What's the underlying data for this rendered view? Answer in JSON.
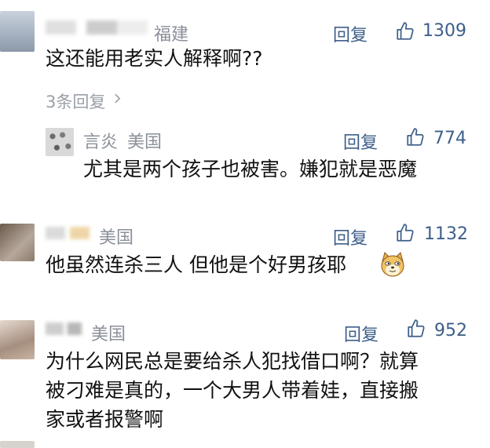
{
  "comments": [
    {
      "name": "",
      "region": "福建",
      "reply": "回复",
      "likes": "1309",
      "text": "这还能用老实人解释啊??",
      "more_replies": "3条回复",
      "sub": {
        "name": "言炎",
        "region": "美国",
        "reply": "回复",
        "likes": "774",
        "text": "尤其是两个孩子也被害。嫌犯就是恶魔"
      }
    },
    {
      "name": "",
      "region": "美国",
      "reply": "回复",
      "likes": "1132",
      "text": "他虽然连杀三人 但他是个好男孩耶",
      "emoji": "doge-emoji"
    },
    {
      "name": "",
      "region": "美国",
      "reply": "回复",
      "likes": "952",
      "text_lines": [
        "为什么网民总是要给杀人犯找借口啊？就算",
        "被刁难是真的，一个大男人带着娃，直接搬",
        "家或者报警啊"
      ]
    }
  ],
  "icons": {
    "like": "thumbs-up-icon",
    "chevron": "chevron-right-icon"
  },
  "colors": {
    "link": "#3e5f8a",
    "meta": "#8a8f99",
    "text": "#111111"
  }
}
